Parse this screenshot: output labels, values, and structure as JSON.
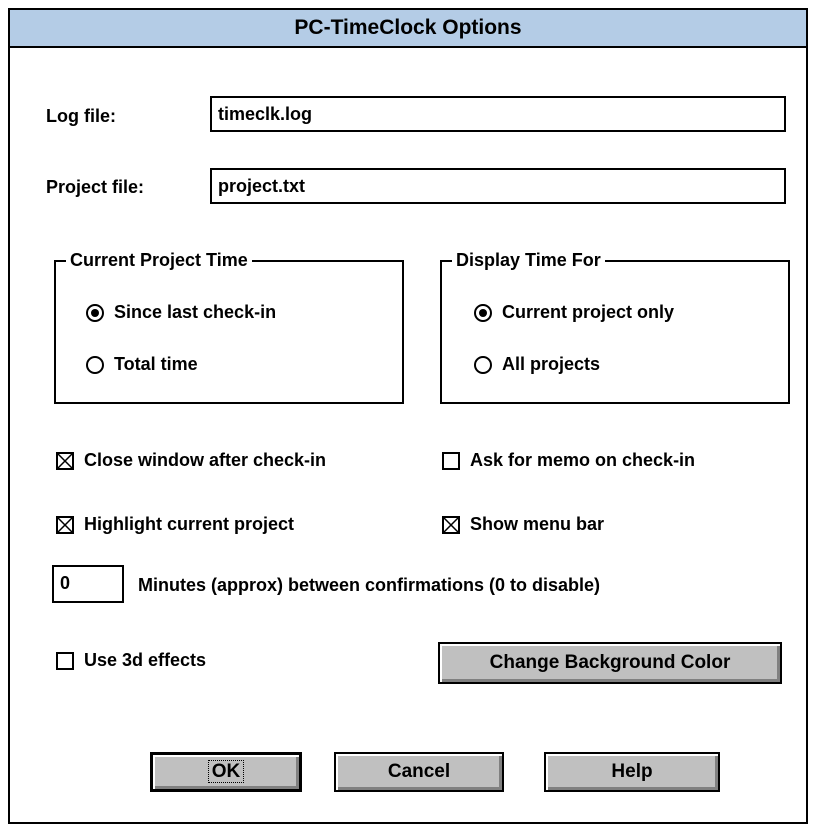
{
  "window": {
    "title": "PC-TimeClock Options"
  },
  "files": {
    "log_label": "Log file:",
    "log_value": "timeclk.log",
    "project_label": "Project file:",
    "project_value": "project.txt"
  },
  "current_project_time": {
    "title": "Current Project Time",
    "options": [
      "Since last check-in",
      "Total time"
    ],
    "selected": "Since last check-in"
  },
  "display_time_for": {
    "title": "Display Time For",
    "options": [
      "Current project only",
      "All projects"
    ],
    "selected": "Current project only"
  },
  "checkboxes": {
    "close_window": {
      "label": "Close window after check-in",
      "checked": true
    },
    "ask_memo": {
      "label": "Ask for memo on check-in",
      "checked": false
    },
    "highlight_project": {
      "label": "Highlight current project",
      "checked": true
    },
    "show_menu_bar": {
      "label": "Show menu bar",
      "checked": true
    },
    "use_3d": {
      "label": "Use 3d effects",
      "checked": false
    }
  },
  "confirmations": {
    "value": "0",
    "label": "Minutes (approx) between confirmations (0 to disable)"
  },
  "buttons": {
    "change_bg": "Change Background Color",
    "ok": "OK",
    "cancel": "Cancel",
    "help": "Help"
  }
}
